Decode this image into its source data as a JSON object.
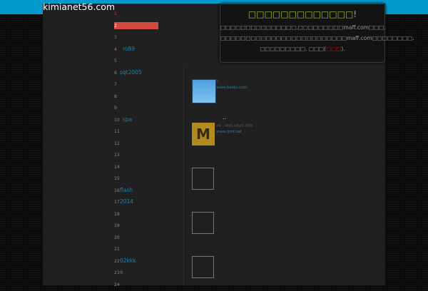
{
  "site_title": "kimianet56.com",
  "list": [
    {
      "n": "1",
      "label": ""
    },
    {
      "n": "2",
      "label": ""
    },
    {
      "n": "3",
      "label": ""
    },
    {
      "n": "4",
      "label": "ro89"
    },
    {
      "n": "5",
      "label": ""
    },
    {
      "n": "6",
      "label": "sqt2005"
    },
    {
      "n": "7",
      "label": ""
    },
    {
      "n": "8",
      "label": ""
    },
    {
      "n": "9",
      "label": ""
    },
    {
      "n": "10",
      "label": "spa"
    },
    {
      "n": "11",
      "label": ""
    },
    {
      "n": "12",
      "label": ""
    },
    {
      "n": "13",
      "label": ""
    },
    {
      "n": "14",
      "label": ""
    },
    {
      "n": "15",
      "label": ""
    },
    {
      "n": "16",
      "label": "flash"
    },
    {
      "n": "17",
      "label": "2014"
    },
    {
      "n": "18",
      "label": ""
    },
    {
      "n": "19",
      "label": ""
    },
    {
      "n": "20",
      "label": ""
    },
    {
      "n": "21",
      "label": ""
    },
    {
      "n": "22",
      "label": "02kkk"
    },
    {
      "n": "23",
      "label": "e"
    },
    {
      "n": "24",
      "label": ""
    }
  ],
  "popup": {
    "title": "□□□□□□□□□□□□□!",
    "line1": "□□□□□□□□□□□□□□□.□□□□□□□□□maff.com□□□.",
    "line2": "□□□□□□□□□□□□□□□□□□□□□□□□□maff.com□□□□□□□□.",
    "line3_a": "□□□□□□□□□. □□□(",
    "line3_link": "□□□",
    "line3_b": ")."
  },
  "entries": [
    {
      "meta": "2 ,    -",
      "link": "www.baidu.com"
    },
    {
      "meta": "24   ,   400-0823-808",
      "link": "www.tjmf.net"
    }
  ],
  "dots": "..",
  "colors": {
    "accent": "#0399cc",
    "active": "#d24b3e",
    "link": "#1a86b0",
    "popup_title": "#a6c21a"
  }
}
